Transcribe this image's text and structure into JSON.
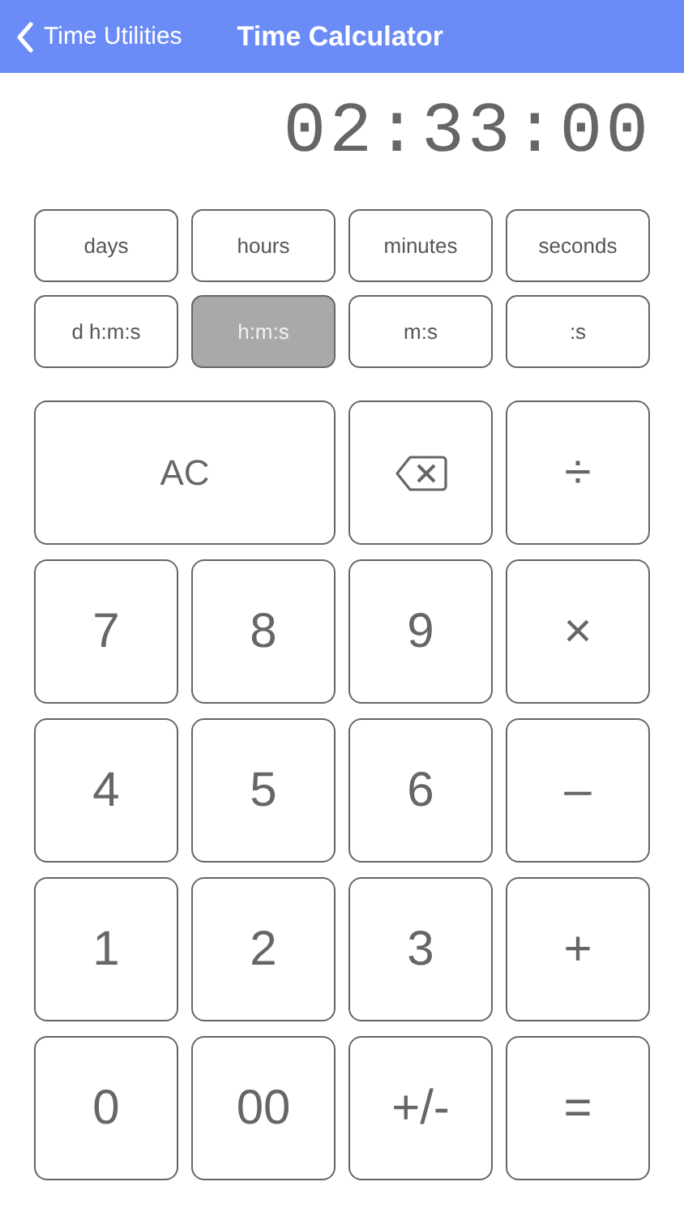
{
  "nav_bar": {
    "back_label": "Time Utilities",
    "title": "Time Calculator"
  },
  "display": "02:33:00",
  "formats": [
    {
      "label": "days",
      "selected": false
    },
    {
      "label": "hours",
      "selected": false
    },
    {
      "label": "minutes",
      "selected": false
    },
    {
      "label": "seconds",
      "selected": false
    },
    {
      "label": "d h:m:s",
      "selected": false
    },
    {
      "label": "h:m:s",
      "selected": true
    },
    {
      "label": "m:s",
      "selected": false
    },
    {
      "label": ":s",
      "selected": false
    }
  ],
  "keys": [
    {
      "kind": "wide",
      "label": "AC"
    },
    {
      "kind": "backspace"
    },
    {
      "kind": "key",
      "label": "÷"
    },
    {
      "kind": "key",
      "label": "7"
    },
    {
      "kind": "key",
      "label": "8"
    },
    {
      "kind": "key",
      "label": "9"
    },
    {
      "kind": "key",
      "label": "×"
    },
    {
      "kind": "key",
      "label": "4"
    },
    {
      "kind": "key",
      "label": "5"
    },
    {
      "kind": "key",
      "label": "6"
    },
    {
      "kind": "key",
      "label": "–"
    },
    {
      "kind": "key",
      "label": "1"
    },
    {
      "kind": "key",
      "label": "2"
    },
    {
      "kind": "key",
      "label": "3"
    },
    {
      "kind": "key",
      "label": "+"
    },
    {
      "kind": "key",
      "label": "0"
    },
    {
      "kind": "key",
      "label": "00"
    },
    {
      "kind": "key",
      "label": "+/-"
    },
    {
      "kind": "key",
      "label": "="
    }
  ]
}
